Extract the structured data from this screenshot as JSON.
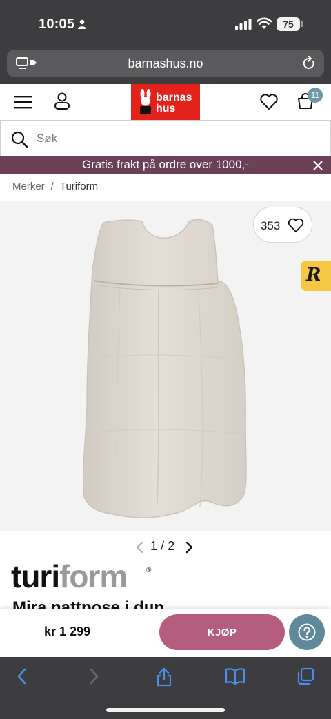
{
  "status_bar": {
    "time": "10:05",
    "battery": "75"
  },
  "browser": {
    "url": "barnashus.no"
  },
  "header": {
    "logo_line1": "barnas",
    "logo_line2": "hus",
    "cart_count": "11",
    "colors": {
      "logo_bg": "#e3221b",
      "badge": "#6f95a8"
    }
  },
  "search": {
    "placeholder": "Søk"
  },
  "promo": {
    "text": "Gratis frakt på ordre over 1000,-",
    "color": "#6b4157"
  },
  "breadcrumb": {
    "items": [
      {
        "label": "Merker"
      },
      {
        "label": "Turiform"
      }
    ],
    "separator": "/"
  },
  "gallery": {
    "like_count": "353",
    "page_current": "1",
    "page_total": "2",
    "page_separator": "/"
  },
  "product": {
    "brand_part_a": "turi",
    "brand_part_b": "form",
    "brand_mark": "®",
    "title": "Mira nattpose i dun",
    "price": "kr 1 299"
  },
  "actions": {
    "buy_label": "KJØP",
    "buy_color": "#b55d7e",
    "help_color": "#5f889b"
  },
  "toolbar": {
    "icons": [
      "back-icon",
      "forward-icon",
      "share-icon",
      "bookmarks-icon",
      "tabs-icon"
    ]
  }
}
